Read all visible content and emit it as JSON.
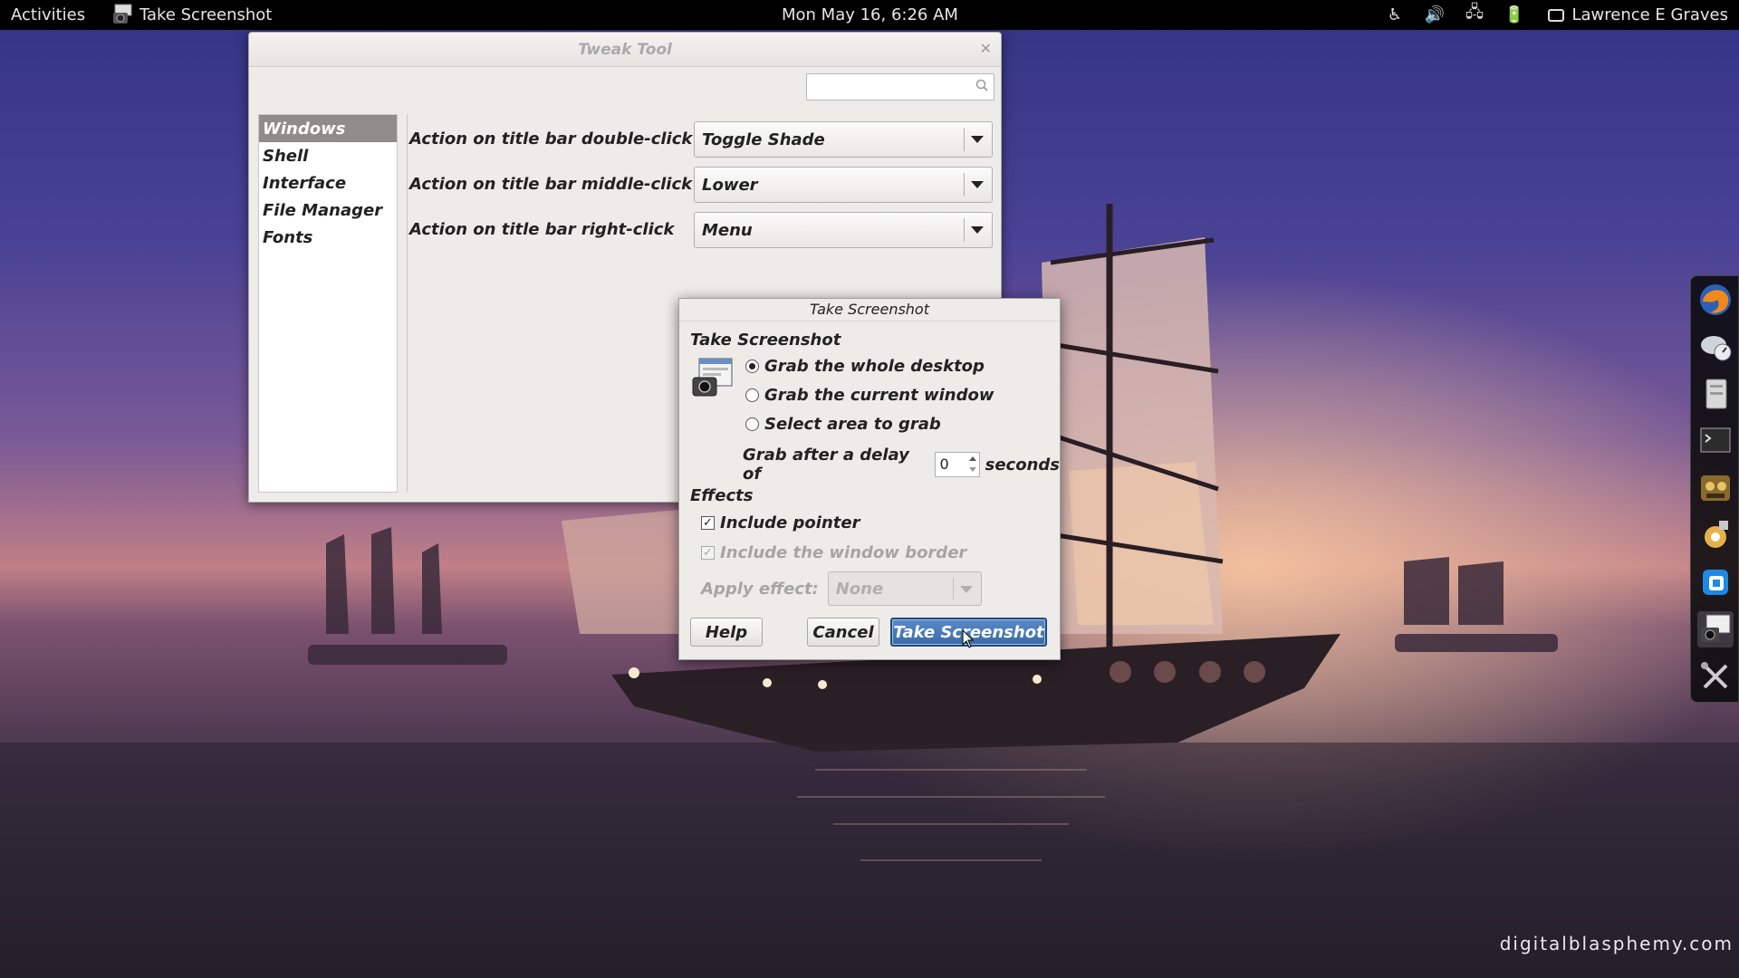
{
  "topbar": {
    "activities": "Activities",
    "app_name": "Take Screenshot",
    "clock": "Mon May 16,  6:26 AM",
    "user": "Lawrence E Graves",
    "tray_icons": [
      "accessibility-icon",
      "volume-icon",
      "network-icon",
      "battery-icon"
    ]
  },
  "tweak": {
    "title": "Tweak Tool",
    "search_placeholder": "",
    "sidebar": [
      "Windows",
      "Shell",
      "Interface",
      "File Manager",
      "Fonts"
    ],
    "selected": "Windows",
    "rows": [
      {
        "label": "Action on title bar double-click",
        "value": "Toggle Shade"
      },
      {
        "label": "Action on title bar middle-click",
        "value": "Lower"
      },
      {
        "label": "Action on title bar right-click",
        "value": "Menu"
      }
    ]
  },
  "dialog": {
    "title": "Take Screenshot",
    "section_take": "Take Screenshot",
    "options": [
      {
        "label": "Grab the whole desktop",
        "selected": true
      },
      {
        "label": "Grab the current window",
        "selected": false
      },
      {
        "label": "Select area to grab",
        "selected": false
      }
    ],
    "delay_prefix": "Grab after a delay of",
    "delay_value": "0",
    "delay_suffix": "seconds",
    "section_effects": "Effects",
    "include_pointer": "Include pointer",
    "include_border": "Include the window border",
    "apply_effect_label": "Apply effect:",
    "apply_effect_value": "None",
    "help": "Help",
    "cancel": "Cancel",
    "take": "Take Screenshot"
  },
  "dock": [
    "firefox-icon",
    "disk-usage-icon",
    "files-icon",
    "terminal-icon",
    "game-icon",
    "update-icon",
    "virtualbox-icon",
    "screenshot-icon",
    "tweak-tool-icon"
  ],
  "watermark": "digitalblasphemy.com"
}
